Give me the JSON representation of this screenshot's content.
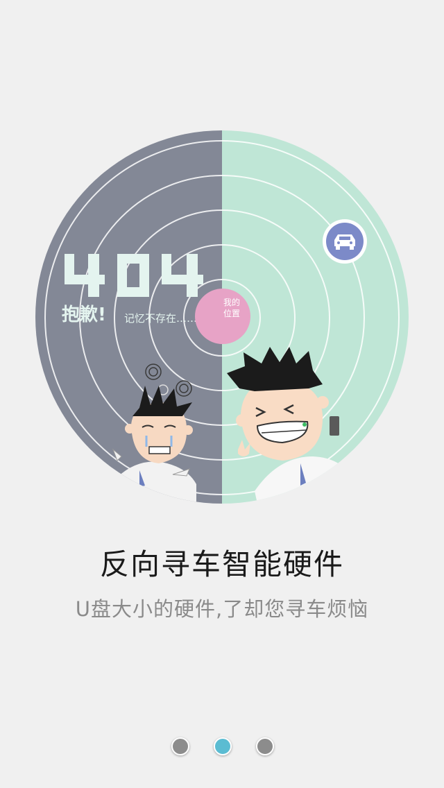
{
  "illustration": {
    "left_text_404": "404",
    "sorry_label": "抱歉!",
    "memory_missing_label": "记忆不存在……",
    "my_location_label": [
      "我的",
      "位置"
    ],
    "colors": {
      "left_panel": "#838896",
      "right_panel": "#bfe6d6",
      "pixel_text": "#e4f4ef",
      "car_marker": "#7c8ac8",
      "location_marker": "#e7a3c6"
    }
  },
  "title": "反向寻车智能硬件",
  "subtitle": "U盘大小的硬件,了却您寻车烦恼",
  "pager": {
    "pages": 3,
    "active_index": 1,
    "colors": {
      "inactive": "#8c8c8c",
      "active": "#5bbcd2"
    }
  }
}
